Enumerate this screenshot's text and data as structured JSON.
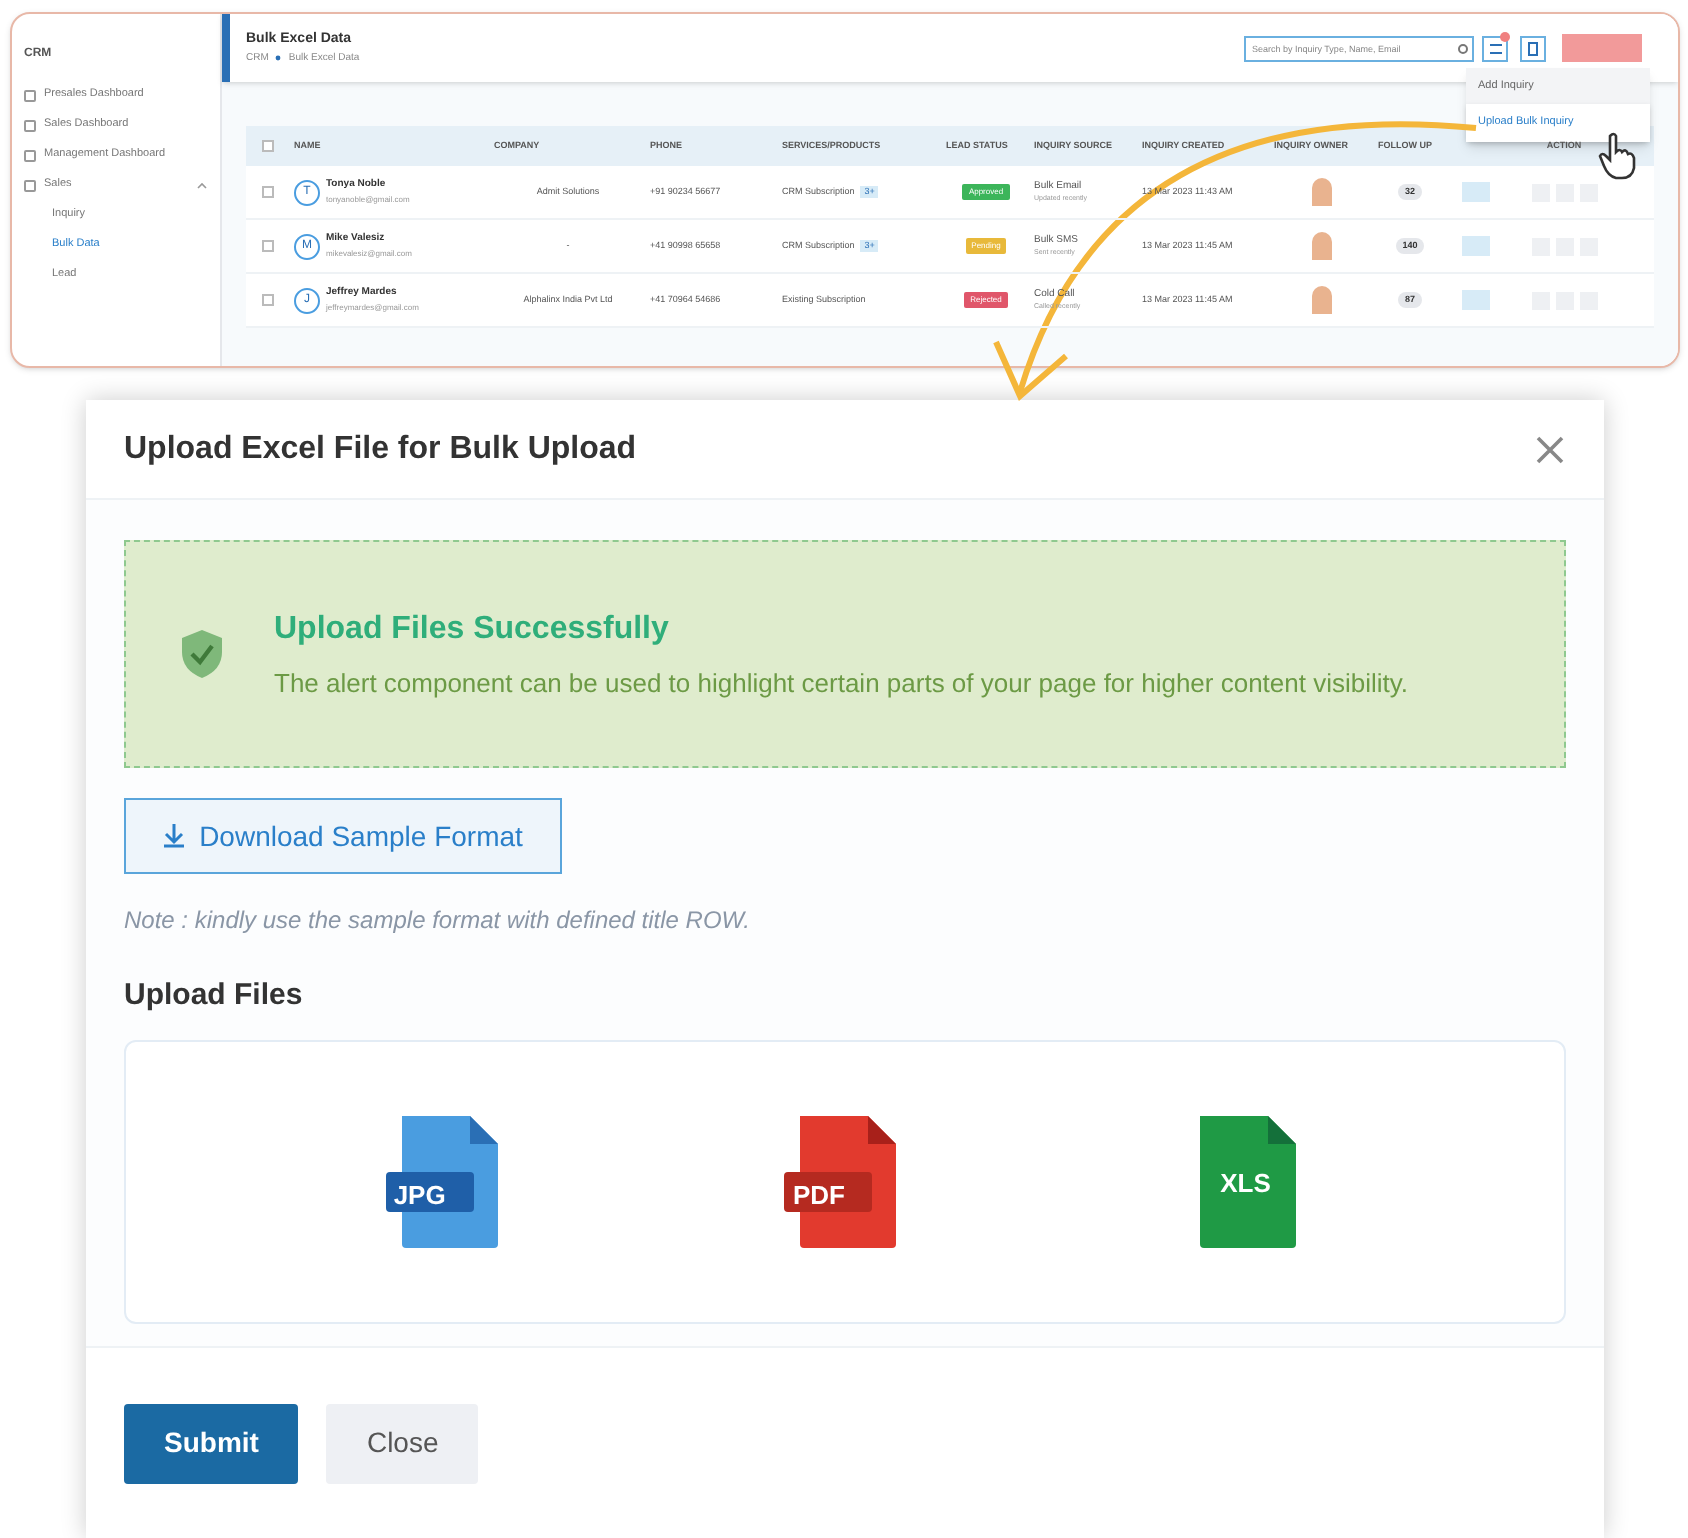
{
  "app": {
    "brand": "CRM"
  },
  "sidebar": {
    "items": [
      {
        "label": "Presales Dashboard",
        "kind": "item",
        "selected": false
      },
      {
        "label": "Sales Dashboard",
        "kind": "item",
        "selected": false
      },
      {
        "label": "Management Dashboard",
        "kind": "item",
        "selected": false
      },
      {
        "label": "Sales",
        "kind": "group",
        "selected": false,
        "expanded": true
      },
      {
        "label": "Inquiry",
        "kind": "subitem",
        "selected": false
      },
      {
        "label": "Bulk Data",
        "kind": "subitem",
        "selected": true
      },
      {
        "label": "Lead",
        "kind": "subitem",
        "selected": false
      }
    ]
  },
  "header": {
    "title": "Bulk Excel Data",
    "breadcrumb": [
      "CRM",
      "Bulk Excel Data"
    ],
    "search": {
      "placeholder": "Search by Inquiry Type, Name, Email"
    }
  },
  "dropdown": {
    "items": [
      {
        "label": "Add Inquiry",
        "selected": false
      },
      {
        "label": "Upload Bulk Inquiry",
        "selected": true
      }
    ]
  },
  "table": {
    "all_checked": false,
    "columns": [
      "NAME",
      "COMPANY",
      "PHONE",
      "SERVICES/PRODUCTS",
      "LEAD STATUS",
      "INQUIRY SOURCE",
      "INQUIRY CREATED",
      "INQUIRY OWNER",
      "FOLLOW UP",
      "",
      "ACTION"
    ],
    "rows": [
      {
        "checked": false,
        "initial": "T",
        "name": "Tonya Noble",
        "email": "tonyanoble@gmail.com",
        "company": "Admit Solutions",
        "phone": "+91 90234 56677",
        "service": "CRM Subscription",
        "extra": "3+",
        "status": {
          "label": "Approved",
          "color": "#3cb55a"
        },
        "source": "Bulk Email",
        "source_note": "Updated recently",
        "created": "13 Mar 2023 11:43 AM",
        "follow_up": "32"
      },
      {
        "checked": false,
        "initial": "M",
        "name": "Mike Valesiz",
        "email": "mikevalesiz@gmail.com",
        "company": "-",
        "phone": "+41 90998 65658",
        "service": "CRM Subscription",
        "extra": "3+",
        "status": {
          "label": "Pending",
          "color": "#e8b93a"
        },
        "source": "Bulk SMS",
        "source_note": "Sent recently",
        "created": "13 Mar 2023 11:45 AM",
        "follow_up": "140"
      },
      {
        "checked": false,
        "initial": "J",
        "name": "Jeffrey Mardes",
        "email": "jeffreymardes@gmail.com",
        "company": "Alphalinx India Pvt Ltd",
        "phone": "+41 70964 54686",
        "service": "Existing Subscription",
        "extra": "",
        "status": {
          "label": "Rejected",
          "color": "#e0566a"
        },
        "source": "Cold Call",
        "source_note": "Called recently",
        "created": "13 Mar 2023 11:45 AM",
        "follow_up": "87"
      }
    ]
  },
  "modal": {
    "title": "Upload Excel File for Bulk Upload",
    "alert": {
      "title": "Upload Files Successfully",
      "text": "The alert component can be used to highlight certain parts of your page for higher content visibility."
    },
    "download_button": "Download Sample Format",
    "note": "Note : kindly use the sample format with defined title ROW.",
    "upload_heading": "Upload Files",
    "files": [
      {
        "kind": "jpg",
        "label": "JPG"
      },
      {
        "kind": "pdf",
        "label": "PDF"
      },
      {
        "kind": "xls",
        "label": "XLS"
      }
    ],
    "buttons": [
      {
        "label": "Submit",
        "kind": "primary"
      },
      {
        "label": "Close",
        "kind": "secondary"
      }
    ]
  }
}
